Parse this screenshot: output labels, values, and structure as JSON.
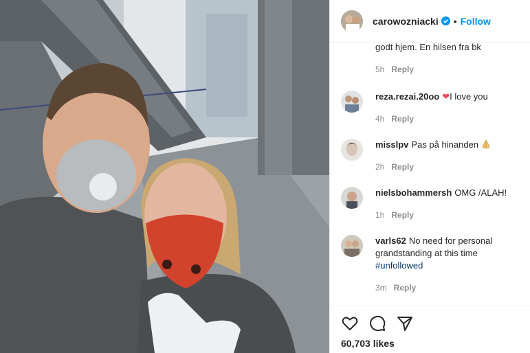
{
  "post": {
    "author": "carowozniacki",
    "verified": true,
    "follow_label": "Follow",
    "separator": "•"
  },
  "comments": [
    {
      "username": "",
      "text": "godt hjem. En hilsen fra bk",
      "time": "5h",
      "reply_label": "Reply"
    },
    {
      "username": "reza.rezai.20oo",
      "text": "I love you",
      "emoji": "heart",
      "time": "4h",
      "reply_label": "Reply"
    },
    {
      "username": "misslpv",
      "text": "Pas på hinanden",
      "emoji": "folded-hands",
      "time": "2h",
      "reply_label": "Reply"
    },
    {
      "username": "nielsbohammersh",
      "text": "OMG /ALAH!",
      "time": "1h",
      "reply_label": "Reply"
    },
    {
      "username": "varls62",
      "text": "No need for personal grandstanding at this time",
      "hashtag": "#unfollowed",
      "time": "3m",
      "reply_label": "Reply"
    }
  ],
  "actions": {
    "icons": [
      "heart-outline-icon",
      "comment-icon",
      "share-icon"
    ],
    "likes": "60,703 likes"
  },
  "colors": {
    "accent": "#0095f6",
    "text": "#262626",
    "secondary": "#8e8e8e",
    "heart": "#ed4956",
    "hashtag": "#00376b"
  }
}
